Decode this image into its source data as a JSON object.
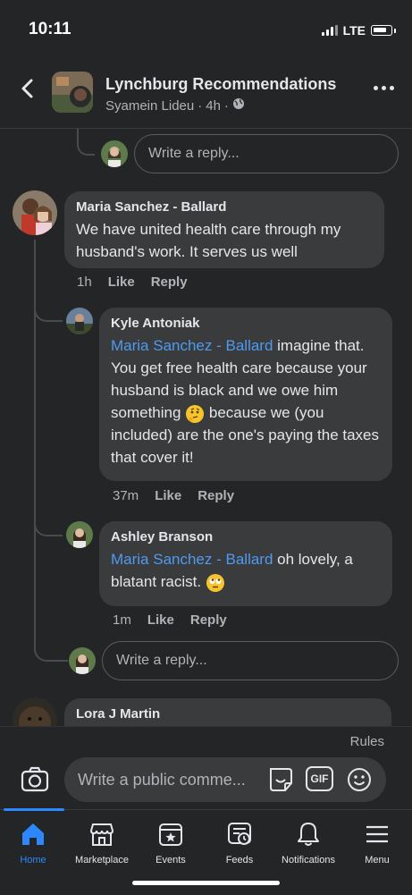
{
  "status": {
    "time": "10:11",
    "network": "LTE"
  },
  "header": {
    "title": "Lynchburg Recommendations",
    "author": "Syamein Lideu",
    "time": "4h",
    "dot": "·"
  },
  "reply_box_top": {
    "placeholder": "Write a reply..."
  },
  "comments": [
    {
      "author": "Maria Sanchez - Ballard",
      "text": "We have united health care through my husband's work. It serves us well",
      "time": "1h",
      "like": "Like",
      "reply": "Reply"
    },
    {
      "author": "Kyle Antoniak",
      "mention": "Maria Sanchez - Ballard",
      "text1": " imagine that. You get free health care because your husband is black and we owe him something ",
      "text2": " because we (you included) are the one's paying the taxes that cover it!",
      "emoji": "thinking-face",
      "time": "37m",
      "like": "Like",
      "reply": "Reply"
    },
    {
      "author": "Ashley Branson",
      "mention": "Maria Sanchez - Ballard",
      "text1": " oh lovely, a blatant racist. ",
      "emoji": "face-with-rolling-eyes",
      "time": "1m",
      "like": "Like",
      "reply": "Reply"
    },
    {
      "author": "Lora J Martin"
    }
  ],
  "reply_box_bottom": {
    "placeholder": "Write a reply..."
  },
  "composer": {
    "rules": "Rules",
    "placeholder": "Write a public comme...",
    "gif": "GIF"
  },
  "tabs": [
    {
      "label": "Home",
      "icon": "home-icon",
      "active": true
    },
    {
      "label": "Marketplace",
      "icon": "marketplace-icon"
    },
    {
      "label": "Events",
      "icon": "events-icon"
    },
    {
      "label": "Feeds",
      "icon": "feeds-icon"
    },
    {
      "label": "Notifications",
      "icon": "bell-icon"
    },
    {
      "label": "Menu",
      "icon": "menu-icon"
    }
  ],
  "colors": {
    "accent": "#2d88ff",
    "mention": "#4e9af1",
    "background": "#242526",
    "bubble": "#3a3b3c"
  }
}
